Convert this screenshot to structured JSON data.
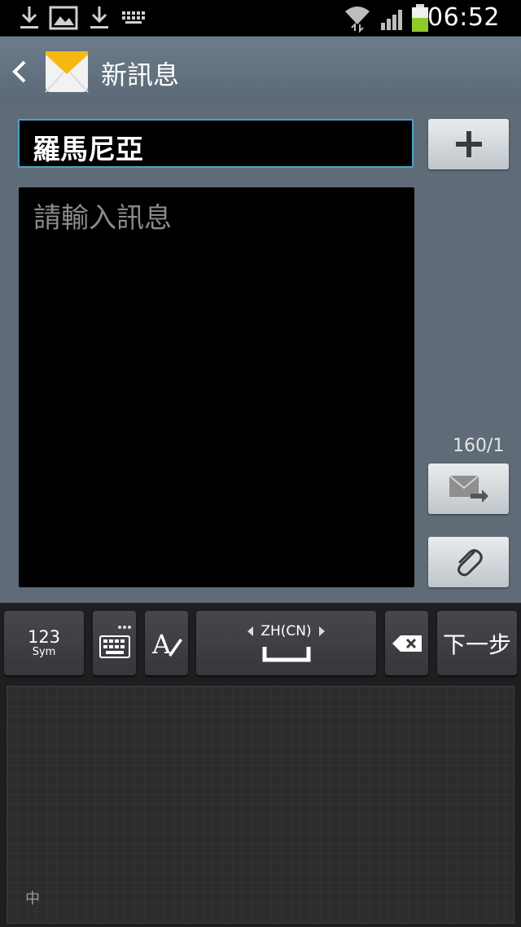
{
  "status_bar": {
    "time": "06:52",
    "left_icons": [
      "download-icon",
      "image-icon",
      "download-icon",
      "keyboard-icon"
    ],
    "right_icons": [
      "wifi-icon",
      "signal-icon",
      "battery-icon"
    ],
    "battery_level": 0.55,
    "battery_color": "#8ccb2a"
  },
  "action_bar": {
    "title": "新訊息",
    "back_icon": "chevron-left-icon",
    "app_icon": "envelope-icon"
  },
  "compose": {
    "recipient": "羅馬尼亞",
    "add_recipient_icon": "plus-icon",
    "message_placeholder": "請輸入訊息",
    "char_counter": "160/1",
    "send_icon": "send-message-icon",
    "attach_icon": "paperclip-icon"
  },
  "keyboard": {
    "sym_key_main": "123",
    "sym_key_sub": "Sym",
    "keyboard_settings_icon": "keyboard-icon",
    "handwriting_icon": "handwriting-icon",
    "language_label": "ZH(CN)",
    "backspace_icon": "backspace-icon",
    "next_label": "下一步",
    "pad_mode_label": "中"
  },
  "colors": {
    "action_bar": "#63717e",
    "compose_bg": "#5f6b77",
    "input_focus_border": "#4aa3c8",
    "keyboard_bg": "#1e1f21"
  }
}
